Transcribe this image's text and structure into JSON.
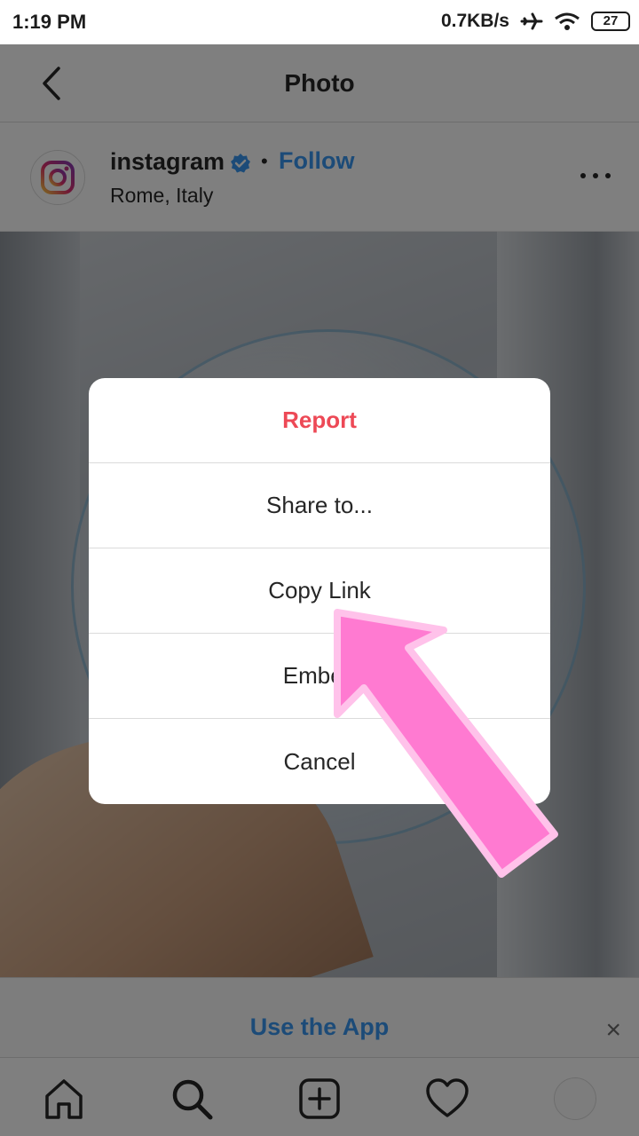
{
  "status_bar": {
    "time": "1:19 PM",
    "network_speed": "0.7KB/s",
    "battery_level": "27",
    "icons": [
      "airplane-icon",
      "wifi-icon",
      "battery-icon"
    ]
  },
  "top_nav": {
    "title": "Photo",
    "back_icon": "chevron-left-icon"
  },
  "post": {
    "username": "instagram",
    "verified_icon": "verified-badge-icon",
    "separator": "•",
    "follow_label": "Follow",
    "location": "Rome, Italy",
    "more_icon": "more-horizontal-icon"
  },
  "dialog": {
    "items": [
      {
        "label": "Report",
        "style": "destructive"
      },
      {
        "label": "Share to..."
      },
      {
        "label": "Copy Link"
      },
      {
        "label": "Embed"
      },
      {
        "label": "Cancel"
      }
    ]
  },
  "banner": {
    "label": "Use the App",
    "close_label": "×"
  },
  "bottom_nav": {
    "tabs": [
      "home-icon",
      "search-icon",
      "new-post-icon",
      "activity-heart-icon",
      "profile-avatar"
    ]
  },
  "colors": {
    "link_blue": "#3897f0",
    "report_red": "#ed4956",
    "annotation_arrow": "#ff7ad1"
  }
}
